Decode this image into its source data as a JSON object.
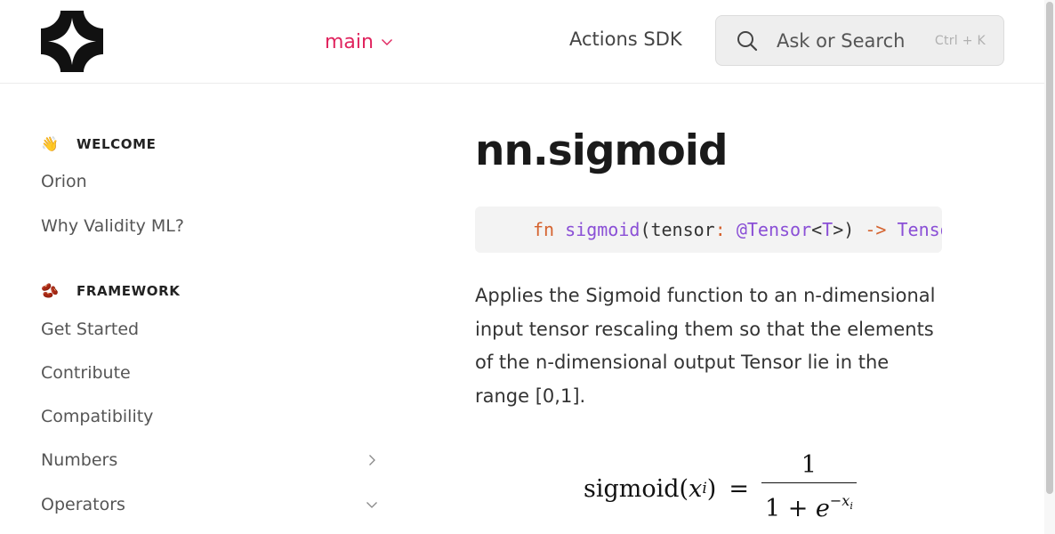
{
  "header": {
    "version_label": "main",
    "actions_link": "Actions SDK",
    "search": {
      "placeholder": "Ask or Search",
      "shortcut": "Ctrl + K"
    }
  },
  "sidebar": {
    "sections": [
      {
        "emoji": "👋",
        "title": "WELCOME",
        "items": [
          {
            "label": "Orion"
          },
          {
            "label": "Why Validity ML?"
          }
        ]
      },
      {
        "emoji": "🫘",
        "title": "FRAMEWORK",
        "items": [
          {
            "label": "Get Started"
          },
          {
            "label": "Contribute"
          },
          {
            "label": "Compatibility"
          },
          {
            "label": "Numbers",
            "chevron": "chevron-right-icon"
          },
          {
            "label": "Operators",
            "chevron": "chevron-down-icon"
          }
        ]
      }
    ]
  },
  "main": {
    "title": "nn.sigmoid",
    "code": {
      "kw": "fn",
      "name": "sigmoid",
      "open": "(tensor",
      "colon": ":",
      "at": "@Tensor",
      "lt": "<",
      "t": "T",
      "gt": ">)",
      "arrow": "->",
      "ret": "Tensor<T>"
    },
    "description": "Applies the Sigmoid function to an n-dimensional input tensor rescaling them so that the elements of the n-dimensional output Tensor lie in the range [0,1].",
    "formula": {
      "lhs": "sigmoid(",
      "var": "x",
      "sub": "i",
      "rhs_close": ")",
      "equals": "=",
      "numerator": "1",
      "denominator_base": "1 + ",
      "e": "e",
      "exponent": "−x",
      "exponent_sub": "i"
    }
  },
  "colors": {
    "accent": "#e0245e",
    "keyword": "#d5632f",
    "type": "#8a4fd6"
  }
}
